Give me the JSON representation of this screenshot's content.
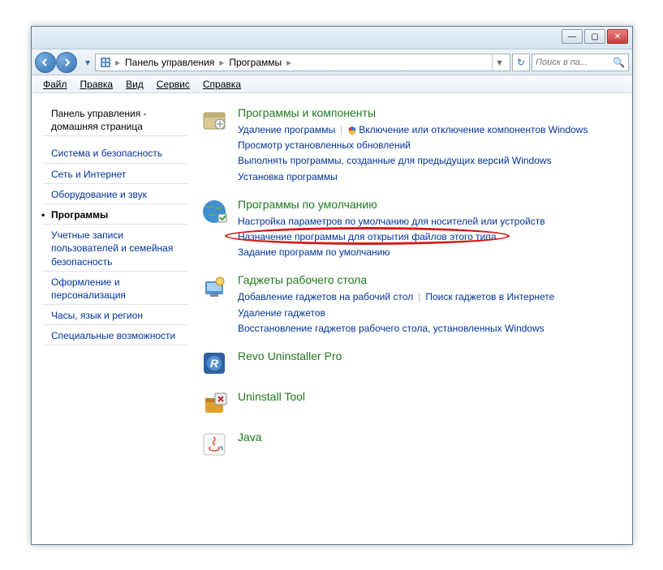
{
  "window": {
    "minimize": "—",
    "maximize": "▢",
    "close": "✕"
  },
  "breadcrumb": {
    "root_arrow": "▸",
    "item1": "Панель управления",
    "item2": "Программы",
    "sep": "▸",
    "dropdown": "▾",
    "refresh": "↻"
  },
  "search": {
    "placeholder": "Поиск в па...",
    "icon": "🔍"
  },
  "menu": {
    "file": "Файл",
    "edit": "Правка",
    "view": "Вид",
    "service": "Сервис",
    "help": "Справка"
  },
  "sidebar": {
    "home": "Панель управления - домашняя страница",
    "items": [
      "Система и безопасность",
      "Сеть и Интернет",
      "Оборудование и звук",
      "Программы",
      "Учетные записи пользователей и семейная безопасность",
      "Оформление и персонализация",
      "Часы, язык и регион",
      "Специальные возможности"
    ]
  },
  "categories": [
    {
      "title": "Программы и компоненты",
      "icon": "box",
      "links": [
        {
          "text": "Удаление программы",
          "shield": false
        },
        {
          "text": "Включение или отключение компонентов Windows",
          "shield": true,
          "br": true
        },
        {
          "text": "Просмотр установленных обновлений",
          "br": true
        },
        {
          "text": "Выполнять программы, созданные для предыдущих версий Windows",
          "br": true
        },
        {
          "text": "Установка программы"
        }
      ]
    },
    {
      "title": "Программы по умолчанию",
      "icon": "globe",
      "links": [
        {
          "text": "Настройка параметров по умолчанию для носителей или устройств",
          "br": true
        },
        {
          "text": "Назначение программы для открытия файлов этого типа",
          "br": true,
          "highlight": true
        },
        {
          "text": "Задание программ по умолчанию"
        }
      ]
    },
    {
      "title": "Гаджеты рабочего стола",
      "icon": "gadget",
      "links": [
        {
          "text": "Добавление гаджетов на рабочий стол"
        },
        {
          "text": "Поиск гаджетов в Интернете",
          "br": true
        },
        {
          "text": "Удаление гаджетов",
          "br": true
        },
        {
          "text": "Восстановление гаджетов рабочего стола, установленных Windows"
        }
      ]
    },
    {
      "title": "Revo Uninstaller Pro",
      "icon": "revo",
      "links": []
    },
    {
      "title": "Uninstall Tool",
      "icon": "uninstall",
      "links": []
    },
    {
      "title": "Java",
      "icon": "java",
      "links": []
    }
  ]
}
